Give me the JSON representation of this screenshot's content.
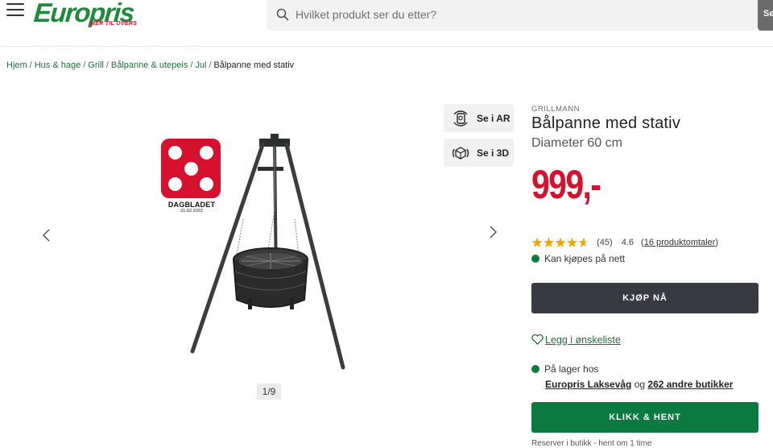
{
  "header": {
    "logo_text": "Europris",
    "logo_tagline": "MER TIL OVERS",
    "search_placeholder": "Hvilket produkt ser du etter?",
    "search_button": "Søk"
  },
  "breadcrumb": {
    "items": [
      "Hjem",
      "Hus & hage",
      "Grill",
      "Bålpanne & utepeis",
      "Jul"
    ],
    "current": "Bålpanne med stativ",
    "separator": "/"
  },
  "gallery": {
    "ar_label": "Se i AR",
    "view3d_label": "Se i 3D",
    "badge_name": "DAGBLADET",
    "badge_date": "21.02.2022",
    "counter": "1/9"
  },
  "product": {
    "brand": "GRILLMANN",
    "title": "Bålpanne med stativ",
    "subtitle": "Diameter 60 cm",
    "price": "999,-",
    "rating_count": "(45)",
    "rating_average": "4.6",
    "rating_value": 4.6,
    "reviews_link": "16 produktomtaler",
    "reviews_open": "(",
    "reviews_close": ")",
    "online_status": "Kan kjøpes på nett",
    "buy_button": "KJØP NÅ",
    "wishlist": "Legg i ønskeliste",
    "stock_status": "På lager hos",
    "store_name": "Europris Laksevåg",
    "stores_joiner": " og ",
    "other_stores": "262 andre butikker",
    "collect_button": "KLIKK & HENT",
    "reserve_note": "Reserver i butikk - hent om 1 time"
  },
  "colors": {
    "brand_green": "#1e8a3c",
    "price_red": "#d6112e",
    "buy_button": "#373a43",
    "collect_button": "#0b7a3e",
    "star": "#f0a800"
  }
}
